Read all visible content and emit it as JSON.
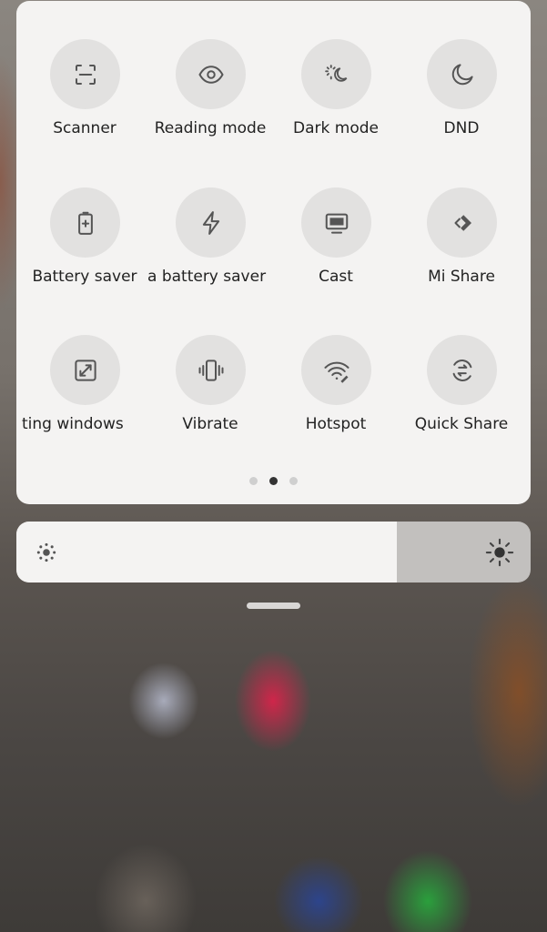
{
  "tiles": [
    {
      "id": "scanner",
      "label": "Scanner",
      "icon": "scanner-icon"
    },
    {
      "id": "reading-mode",
      "label": "Reading mode",
      "icon": "eye-icon"
    },
    {
      "id": "dark-mode",
      "label": "Dark mode",
      "icon": "dark-mode-icon"
    },
    {
      "id": "dnd",
      "label": "DND",
      "icon": "moon-icon"
    },
    {
      "id": "battery-saver",
      "label": "Battery saver",
      "icon": "battery-icon"
    },
    {
      "id": "ultra-battery-saver",
      "label": "a battery saver",
      "icon": "lightning-icon"
    },
    {
      "id": "cast",
      "label": "Cast",
      "icon": "monitor-icon"
    },
    {
      "id": "mi-share",
      "label": "Mi Share",
      "icon": "mi-share-icon"
    },
    {
      "id": "floating-windows",
      "label": "ting windows",
      "icon": "floating-window-icon"
    },
    {
      "id": "vibrate",
      "label": "Vibrate",
      "icon": "vibrate-icon"
    },
    {
      "id": "hotspot",
      "label": "Hotspot",
      "icon": "hotspot-icon"
    },
    {
      "id": "quick-share",
      "label": "Quick Share",
      "icon": "quick-share-icon"
    }
  ],
  "pager": {
    "count": 3,
    "active": 1
  },
  "brightness": {
    "level": 0.74
  },
  "colors": {
    "panel": "#f4f3f2",
    "tile": "#e2e1e0",
    "icon": "#555555",
    "label": "#222222",
    "dot_active": "#333333",
    "dot_inactive": "#cfcfcf",
    "slider_track": "#c2c0be"
  }
}
